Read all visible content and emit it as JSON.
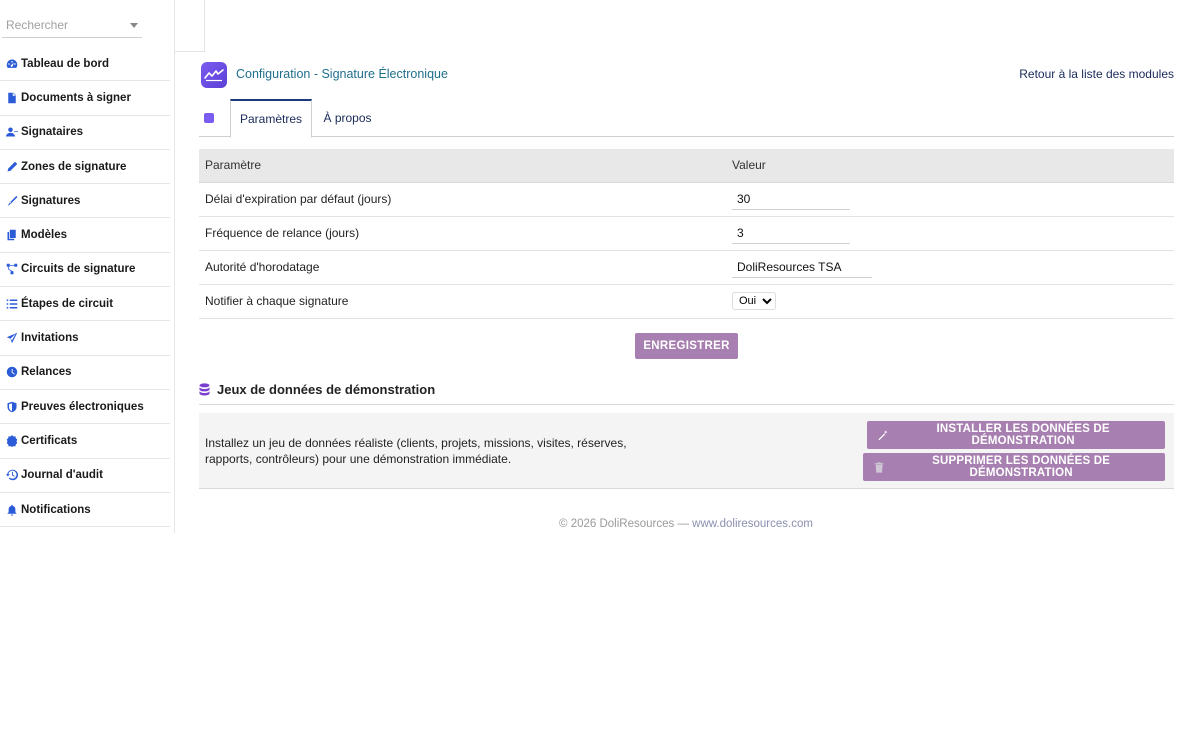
{
  "search": {
    "placeholder": "Rechercher"
  },
  "sidebar": {
    "items": [
      {
        "label": "Tableau de bord",
        "icon": "dashboard-icon"
      },
      {
        "label": "Documents à signer",
        "icon": "document-icon"
      },
      {
        "label": "Signataires",
        "icon": "users-icon"
      },
      {
        "label": "Zones de signature",
        "icon": "pen-icon"
      },
      {
        "label": "Signatures",
        "icon": "signature-icon"
      },
      {
        "label": "Modèles",
        "icon": "copy-icon"
      },
      {
        "label": "Circuits de signature",
        "icon": "workflow-icon"
      },
      {
        "label": "Étapes de circuit",
        "icon": "list-icon"
      },
      {
        "label": "Invitations",
        "icon": "paper-plane-icon"
      },
      {
        "label": "Relances",
        "icon": "clock-icon"
      },
      {
        "label": "Preuves électroniques",
        "icon": "shield-icon"
      },
      {
        "label": "Certificats",
        "icon": "certificate-icon"
      },
      {
        "label": "Journal d'audit",
        "icon": "history-icon"
      },
      {
        "label": "Notifications",
        "icon": "bell-icon"
      }
    ]
  },
  "header": {
    "title": "Configuration - Signature Électronique",
    "back_link": "Retour à la liste des modules"
  },
  "tabs": [
    {
      "label": "Paramètres",
      "active": true
    },
    {
      "label": "À propos",
      "active": false
    }
  ],
  "params": {
    "col_param": "Paramètre",
    "col_value": "Valeur",
    "rows": [
      {
        "label": "Délai d'expiration par défaut (jours)",
        "value": "30",
        "type": "text"
      },
      {
        "label": "Fréquence de relance (jours)",
        "value": "3",
        "type": "text"
      },
      {
        "label": "Autorité d'horodatage",
        "value": "DoliResources TSA",
        "type": "text"
      },
      {
        "label": "Notifier à chaque signature",
        "value": "Oui",
        "type": "select"
      }
    ]
  },
  "save_button": "ENREGISTRER",
  "demo": {
    "title": "Jeux de données de démonstration",
    "description": "Installez un jeu de données réaliste (clients, projets, missions, visites, réserves, rapports, contrôleurs) pour une démonstration immédiate.",
    "install_button": "INSTALLER LES DONNÉES DE DÉMONSTRATION",
    "delete_button": "SUPPRIMER LES DONNÉES DE DÉMONSTRATION"
  },
  "footer": {
    "copyright": "© 2026 DoliResources — ",
    "site": "www.doliresources.com"
  },
  "colors": {
    "accent_purple": "#a77fb0",
    "menu_icon_blue": "#2b5bd7",
    "title_teal": "#1f6f8b",
    "logo_purple": "#7b5cf0"
  }
}
